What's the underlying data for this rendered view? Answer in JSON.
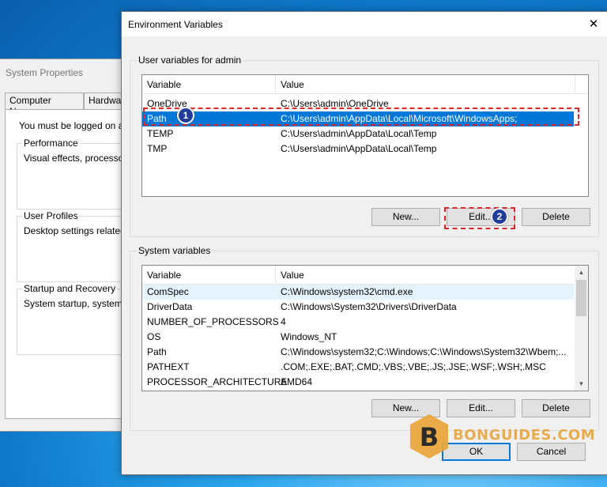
{
  "system_properties": {
    "title": "System Properties",
    "tabs": [
      "Computer Name",
      "Hardware"
    ],
    "note": "You must be logged on as a",
    "groups": [
      {
        "legend": "Performance",
        "desc": "Visual effects, processor s"
      },
      {
        "legend": "User Profiles",
        "desc": "Desktop settings related to"
      },
      {
        "legend": "Startup and Recovery",
        "desc": "System startup, system fail"
      }
    ]
  },
  "dialog": {
    "title": "Environment Variables",
    "close_icon": "close-icon",
    "user_vars": {
      "legend": "User variables for admin",
      "headers": [
        "Variable",
        "Value"
      ],
      "rows": [
        [
          "OneDrive",
          "C:\\Users\\admin\\OneDrive"
        ],
        [
          "Path",
          "C:\\Users\\admin\\AppData\\Local\\Microsoft\\WindowsApps;"
        ],
        [
          "TEMP",
          "C:\\Users\\admin\\AppData\\Local\\Temp"
        ],
        [
          "TMP",
          "C:\\Users\\admin\\AppData\\Local\\Temp"
        ]
      ],
      "selected_index": 1,
      "buttons": {
        "new": "New...",
        "edit": "Edit...",
        "delete": "Delete"
      }
    },
    "system_vars": {
      "legend": "System variables",
      "headers": [
        "Variable",
        "Value"
      ],
      "rows": [
        [
          "ComSpec",
          "C:\\Windows\\system32\\cmd.exe"
        ],
        [
          "DriverData",
          "C:\\Windows\\System32\\Drivers\\DriverData"
        ],
        [
          "NUMBER_OF_PROCESSORS",
          "4"
        ],
        [
          "OS",
          "Windows_NT"
        ],
        [
          "Path",
          "C:\\Windows\\system32;C:\\Windows;C:\\Windows\\System32\\Wbem;..."
        ],
        [
          "PATHEXT",
          ".COM;.EXE;.BAT;.CMD;.VBS;.VBE;.JS;.JSE;.WSF;.WSH;.MSC"
        ],
        [
          "PROCESSOR_ARCHITECTURE",
          "AMD64"
        ]
      ],
      "buttons": {
        "new": "New...",
        "edit": "Edit...",
        "delete": "Delete"
      }
    },
    "ok_label": "OK",
    "cancel_label": "Cancel"
  },
  "annotations": {
    "badge1": "1",
    "badge2": "2",
    "highlight_color": "#d8262b",
    "badge_color": "#1f3d99"
  },
  "watermark": {
    "text": "BONGUIDES.COM",
    "logo_letter": "B"
  },
  "colors": {
    "selection": "#0078d7",
    "accent": "#0078d7"
  }
}
